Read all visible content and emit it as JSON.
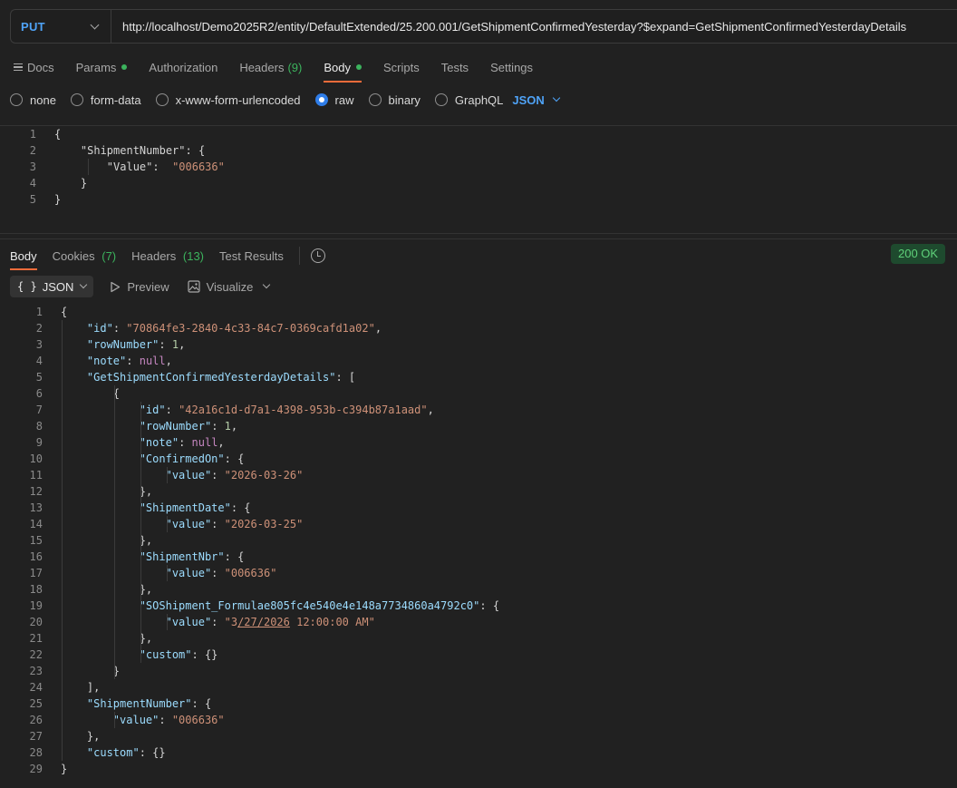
{
  "request": {
    "method": "PUT",
    "url": "http://localhost/Demo2025R2/entity/DefaultExtended/25.200.001/GetShipmentConfirmedYesterday?$expand=GetShipmentConfirmedYesterdayDetails"
  },
  "request_tabs": {
    "docs": "Docs",
    "params": "Params",
    "authorization": "Authorization",
    "headers": "Headers",
    "headers_count": "(9)",
    "body": "Body",
    "scripts": "Scripts",
    "tests": "Tests",
    "settings": "Settings"
  },
  "body_types": {
    "none": "none",
    "form_data": "form-data",
    "urlencoded": "x-www-form-urlencoded",
    "raw": "raw",
    "binary": "binary",
    "graphql": "GraphQL",
    "language": "JSON"
  },
  "request_body": {
    "lines": [
      [
        {
          "t": "p",
          "v": "{"
        }
      ],
      [
        {
          "t": "p",
          "v": "    "
        },
        {
          "t": "k",
          "v": "\"ShipmentNumber\""
        },
        {
          "t": "p",
          "v": ": {"
        }
      ],
      [
        {
          "t": "p",
          "v": "        "
        },
        {
          "t": "k",
          "v": "\"Value\""
        },
        {
          "t": "p",
          "v": ":  "
        },
        {
          "t": "s",
          "v": "\"006636\""
        }
      ],
      [
        {
          "t": "p",
          "v": "    }"
        }
      ],
      [
        {
          "t": "p",
          "v": "}"
        }
      ]
    ]
  },
  "response_tabs": {
    "body": "Body",
    "cookies": "Cookies",
    "cookies_count": "(7)",
    "headers": "Headers",
    "headers_count": "(13)",
    "test_results": "Test Results",
    "status": "200 OK"
  },
  "response_toolbar": {
    "format": "JSON",
    "braces": "{ }",
    "preview": "Preview",
    "visualize": "Visualize"
  },
  "response_body": {
    "lines": [
      [
        {
          "t": "p",
          "v": "{"
        }
      ],
      [
        {
          "t": "p",
          "v": "    "
        },
        {
          "t": "k",
          "v": "\"id\""
        },
        {
          "t": "p",
          "v": ": "
        },
        {
          "t": "s",
          "v": "\"70864fe3-2840-4c33-84c7-0369cafd1a02\""
        },
        {
          "t": "p",
          "v": ","
        }
      ],
      [
        {
          "t": "p",
          "v": "    "
        },
        {
          "t": "k",
          "v": "\"rowNumber\""
        },
        {
          "t": "p",
          "v": ": "
        },
        {
          "t": "n",
          "v": "1"
        },
        {
          "t": "p",
          "v": ","
        }
      ],
      [
        {
          "t": "p",
          "v": "    "
        },
        {
          "t": "k",
          "v": "\"note\""
        },
        {
          "t": "p",
          "v": ": "
        },
        {
          "t": "kw",
          "v": "null"
        },
        {
          "t": "p",
          "v": ","
        }
      ],
      [
        {
          "t": "p",
          "v": "    "
        },
        {
          "t": "k",
          "v": "\"GetShipmentConfirmedYesterdayDetails\""
        },
        {
          "t": "p",
          "v": ": ["
        }
      ],
      [
        {
          "t": "p",
          "v": "        {"
        }
      ],
      [
        {
          "t": "p",
          "v": "            "
        },
        {
          "t": "k",
          "v": "\"id\""
        },
        {
          "t": "p",
          "v": ": "
        },
        {
          "t": "s",
          "v": "\"42a16c1d-d7a1-4398-953b-c394b87a1aad\""
        },
        {
          "t": "p",
          "v": ","
        }
      ],
      [
        {
          "t": "p",
          "v": "            "
        },
        {
          "t": "k",
          "v": "\"rowNumber\""
        },
        {
          "t": "p",
          "v": ": "
        },
        {
          "t": "n",
          "v": "1"
        },
        {
          "t": "p",
          "v": ","
        }
      ],
      [
        {
          "t": "p",
          "v": "            "
        },
        {
          "t": "k",
          "v": "\"note\""
        },
        {
          "t": "p",
          "v": ": "
        },
        {
          "t": "kw",
          "v": "null"
        },
        {
          "t": "p",
          "v": ","
        }
      ],
      [
        {
          "t": "p",
          "v": "            "
        },
        {
          "t": "k",
          "v": "\"ConfirmedOn\""
        },
        {
          "t": "p",
          "v": ": {"
        }
      ],
      [
        {
          "t": "p",
          "v": "                "
        },
        {
          "t": "k",
          "v": "\"value\""
        },
        {
          "t": "p",
          "v": ": "
        },
        {
          "t": "s",
          "v": "\"2026-03-26\""
        }
      ],
      [
        {
          "t": "p",
          "v": "            },"
        }
      ],
      [
        {
          "t": "p",
          "v": "            "
        },
        {
          "t": "k",
          "v": "\"ShipmentDate\""
        },
        {
          "t": "p",
          "v": ": {"
        }
      ],
      [
        {
          "t": "p",
          "v": "                "
        },
        {
          "t": "k",
          "v": "\"value\""
        },
        {
          "t": "p",
          "v": ": "
        },
        {
          "t": "s",
          "v": "\"2026-03-25\""
        }
      ],
      [
        {
          "t": "p",
          "v": "            },"
        }
      ],
      [
        {
          "t": "p",
          "v": "            "
        },
        {
          "t": "k",
          "v": "\"ShipmentNbr\""
        },
        {
          "t": "p",
          "v": ": {"
        }
      ],
      [
        {
          "t": "p",
          "v": "                "
        },
        {
          "t": "k",
          "v": "\"value\""
        },
        {
          "t": "p",
          "v": ": "
        },
        {
          "t": "s",
          "v": "\"006636\""
        }
      ],
      [
        {
          "t": "p",
          "v": "            },"
        }
      ],
      [
        {
          "t": "p",
          "v": "            "
        },
        {
          "t": "k",
          "v": "\"SOShipment_Formulae805fc4e540e4e148a7734860a4792c0\""
        },
        {
          "t": "p",
          "v": ": {"
        }
      ],
      [
        {
          "t": "p",
          "v": "                "
        },
        {
          "t": "k",
          "v": "\"value\""
        },
        {
          "t": "p",
          "v": ": "
        },
        {
          "t": "s",
          "v": "\"3"
        },
        {
          "t": "su",
          "v": "/27/2026"
        },
        {
          "t": "s",
          "v": " 12:00:00 AM\""
        }
      ],
      [
        {
          "t": "p",
          "v": "            },"
        }
      ],
      [
        {
          "t": "p",
          "v": "            "
        },
        {
          "t": "k",
          "v": "\"custom\""
        },
        {
          "t": "p",
          "v": ": {}"
        }
      ],
      [
        {
          "t": "p",
          "v": "        }"
        }
      ],
      [
        {
          "t": "p",
          "v": "    ],"
        }
      ],
      [
        {
          "t": "p",
          "v": "    "
        },
        {
          "t": "k",
          "v": "\"ShipmentNumber\""
        },
        {
          "t": "p",
          "v": ": {"
        }
      ],
      [
        {
          "t": "p",
          "v": "        "
        },
        {
          "t": "k",
          "v": "\"value\""
        },
        {
          "t": "p",
          "v": ": "
        },
        {
          "t": "s",
          "v": "\"006636\""
        }
      ],
      [
        {
          "t": "p",
          "v": "    },"
        }
      ],
      [
        {
          "t": "p",
          "v": "    "
        },
        {
          "t": "k",
          "v": "\"custom\""
        },
        {
          "t": "p",
          "v": ": {}"
        }
      ],
      [
        {
          "t": "p",
          "v": "}"
        }
      ]
    ]
  }
}
